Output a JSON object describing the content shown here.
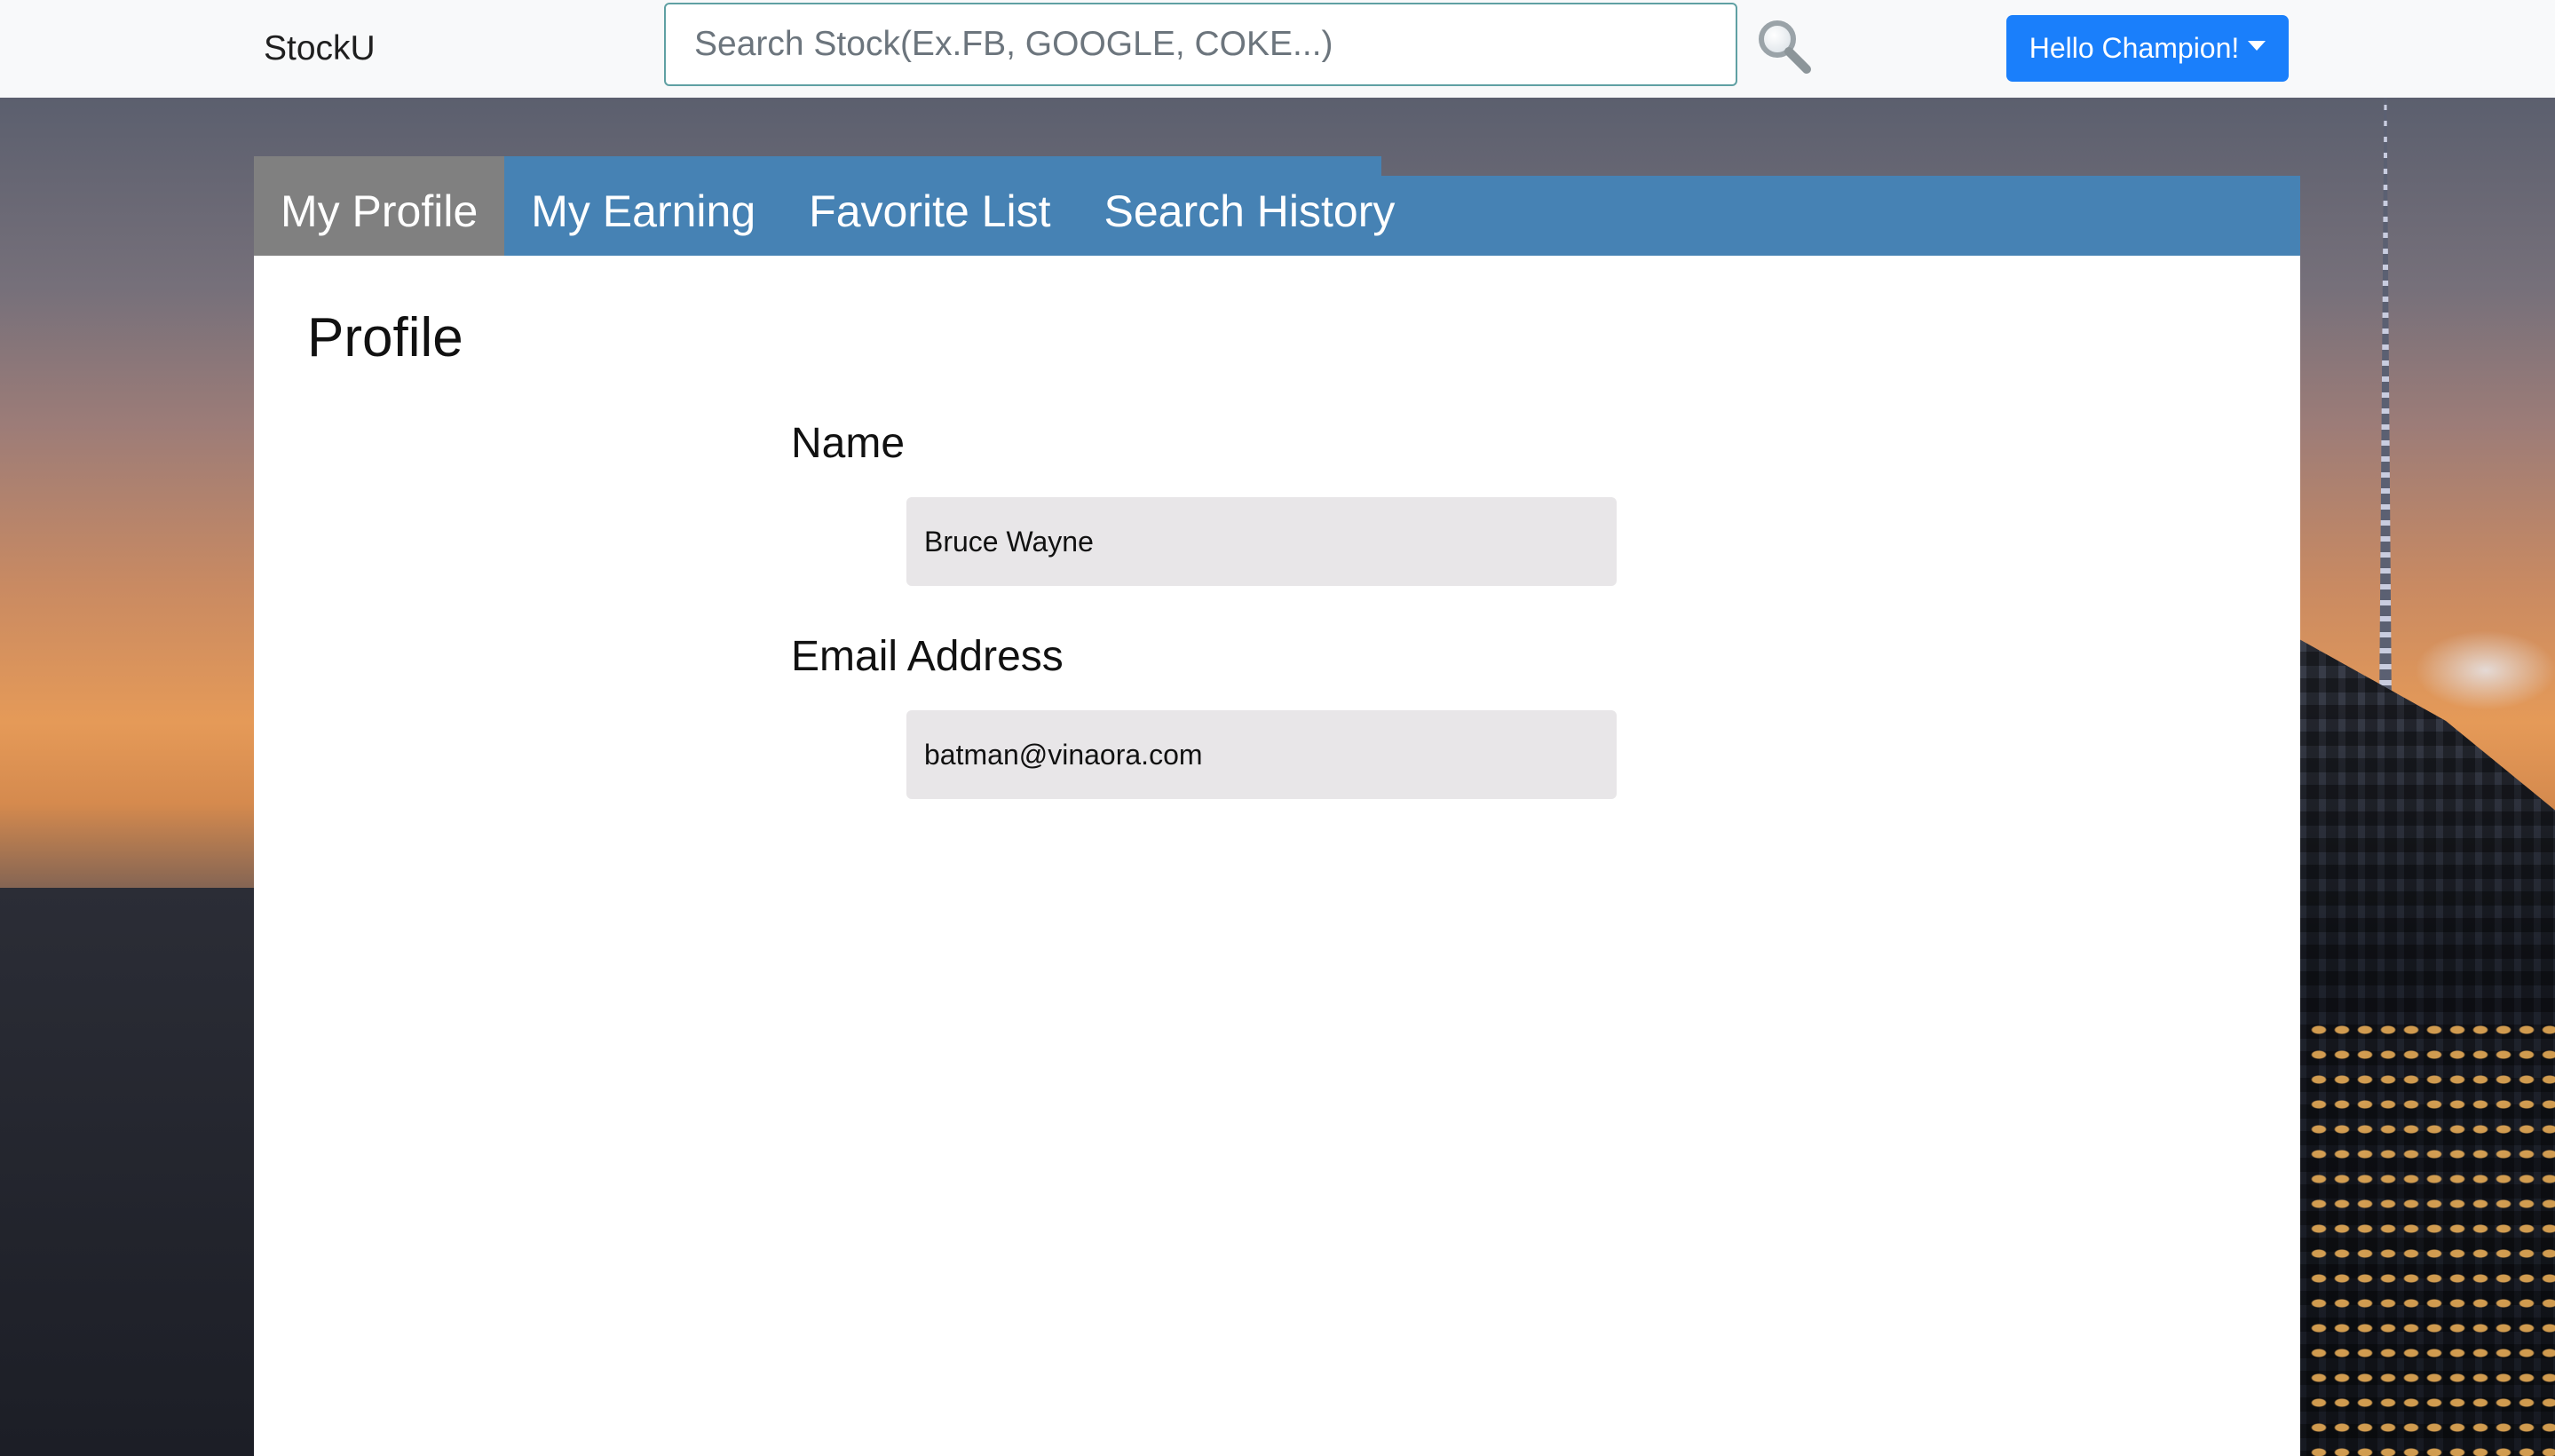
{
  "navbar": {
    "brand": "StockU",
    "search_placeholder": "Search Stock(Ex.FB, GOOGLE, COKE...)",
    "search_icon": "magnifier-icon",
    "user_menu_label": "Hello Champion!",
    "user_menu_icon": "caret-down-icon"
  },
  "tabs": [
    {
      "label": "My Profile",
      "active": true
    },
    {
      "label": "My Earning",
      "active": false
    },
    {
      "label": "Favorite List",
      "active": false
    },
    {
      "label": "Search History",
      "active": false
    }
  ],
  "profile": {
    "title": "Profile",
    "name_label": "Name",
    "name_value": "Bruce Wayne",
    "email_label": "Email Address",
    "email_value": "batman@vinaora.com"
  },
  "colors": {
    "navbar_bg": "#f8f9fa",
    "tab_bar": "#4682b4",
    "tab_active": "#808080",
    "user_button": "#1a7ffb",
    "field_bg": "#e8e6e8"
  }
}
